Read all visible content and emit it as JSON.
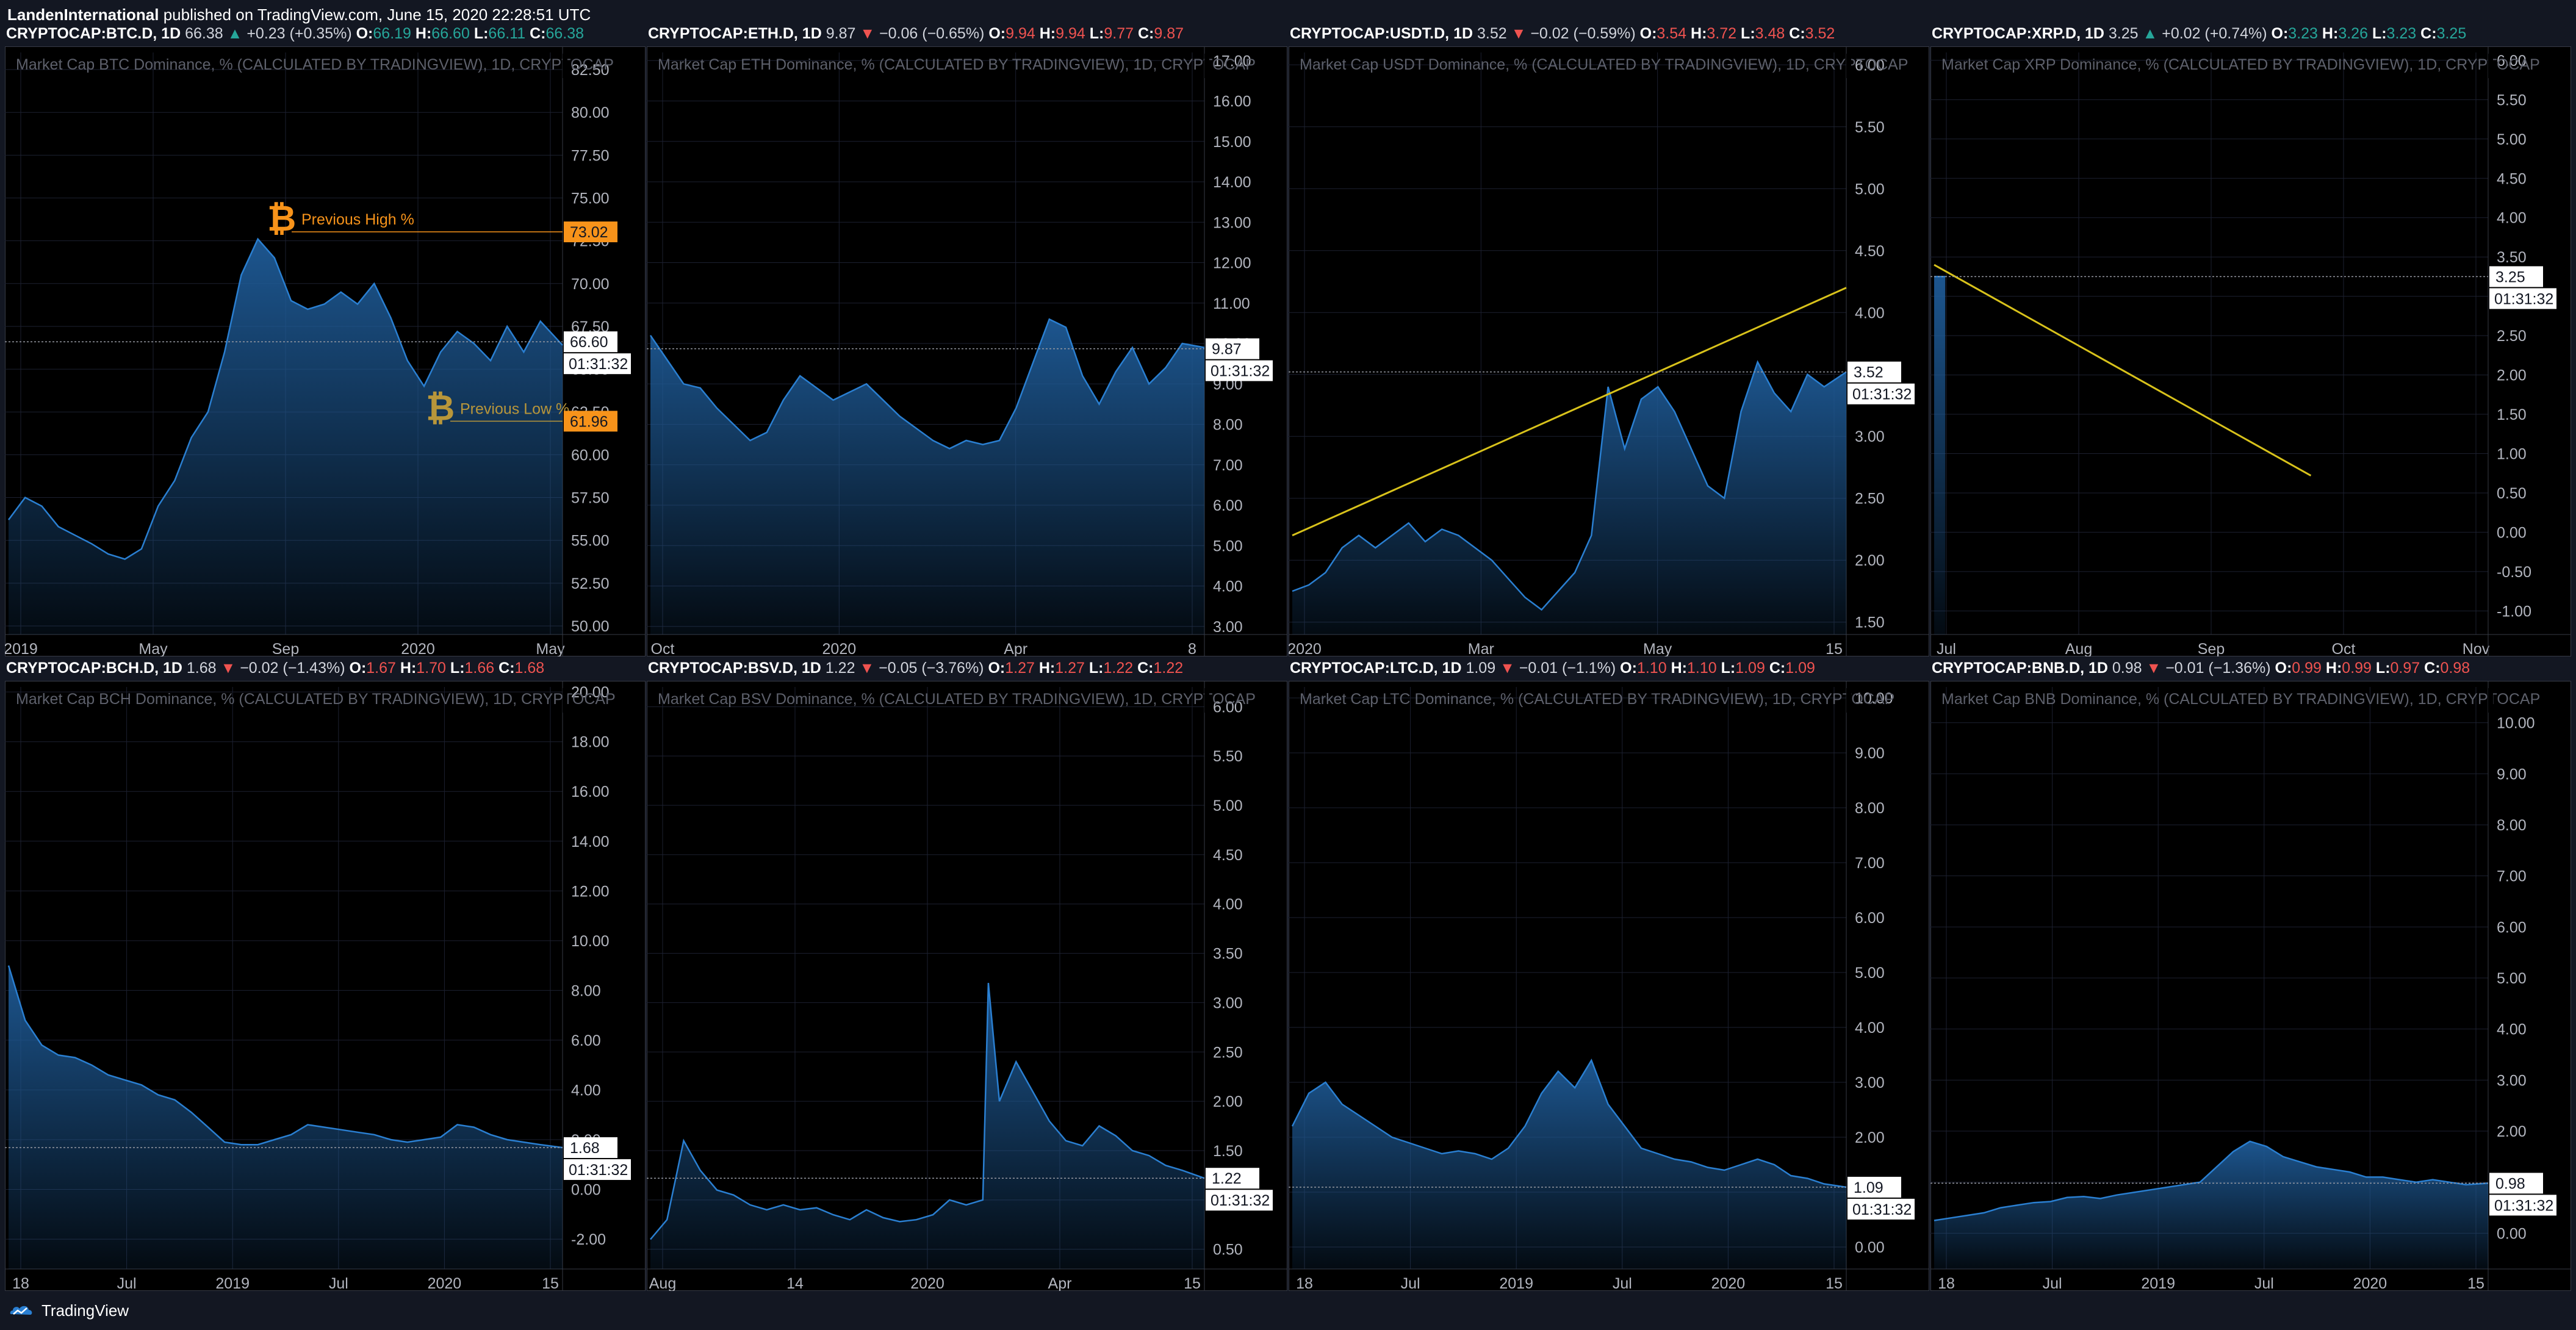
{
  "header": {
    "author": "LandenInternational",
    "published": "published on TradingView.com, June 15, 2020 22:28:51 UTC"
  },
  "footer": {
    "brand": "TradingView"
  },
  "colors": {
    "line": "#2a7fd1",
    "fill_top": "#1e5a96",
    "up": "#26a69a",
    "down": "#ef5350",
    "trend": "#d8c21b",
    "btc": "#f7931a"
  },
  "countdown": "01:31:32",
  "panels": [
    {
      "symbol": "CRYPTOCAP:BTC.D, 1D",
      "last": "66.38",
      "dir": "up",
      "change": "+0.23 (+0.35%)",
      "o": "66.19",
      "h": "66.60",
      "l": "66.11",
      "c": "66.38",
      "title": "Market Cap BTC Dominance, % (CALCULATED BY TRADINGVIEW), 1D, CRYPTOCAP",
      "price_label": "66.60"
    },
    {
      "symbol": "CRYPTOCAP:ETH.D, 1D",
      "last": "9.87",
      "dir": "down",
      "change": "−0.06 (−0.65%)",
      "o": "9.94",
      "h": "9.94",
      "l": "9.77",
      "c": "9.87",
      "title": "Market Cap ETH Dominance, % (CALCULATED BY TRADINGVIEW), 1D, CRYPTOCAP",
      "price_label": "9.87"
    },
    {
      "symbol": "CRYPTOCAP:USDT.D, 1D",
      "last": "3.52",
      "dir": "down",
      "change": "−0.02 (−0.59%)",
      "o": "3.54",
      "h": "3.72",
      "l": "3.48",
      "c": "3.52",
      "title": "Market Cap USDT Dominance, % (CALCULATED BY TRADINGVIEW), 1D, CRYPTOCAP",
      "price_label": "3.52"
    },
    {
      "symbol": "CRYPTOCAP:XRP.D, 1D",
      "last": "3.25",
      "dir": "up",
      "change": "+0.02 (+0.74%)",
      "o": "3.23",
      "h": "3.26",
      "l": "3.23",
      "c": "3.25",
      "title": "Market Cap XRP Dominance, % (CALCULATED BY TRADINGVIEW), 1D, CRYPTOCAP",
      "price_label": "3.25"
    },
    {
      "symbol": "CRYPTOCAP:BCH.D, 1D",
      "last": "1.68",
      "dir": "down",
      "change": "−0.02 (−1.43%)",
      "o": "1.67",
      "h": "1.70",
      "l": "1.66",
      "c": "1.68",
      "title": "Market Cap BCH Dominance, % (CALCULATED BY TRADINGVIEW), 1D, CRYPTOCAP",
      "price_label": "1.68"
    },
    {
      "symbol": "CRYPTOCAP:BSV.D, 1D",
      "last": "1.22",
      "dir": "down",
      "change": "−0.05 (−3.76%)",
      "o": "1.27",
      "h": "1.27",
      "l": "1.22",
      "c": "1.22",
      "title": "Market Cap BSV Dominance, % (CALCULATED BY TRADINGVIEW), 1D, CRYPTOCAP",
      "price_label": "1.22"
    },
    {
      "symbol": "CRYPTOCAP:LTC.D, 1D",
      "last": "1.09",
      "dir": "down",
      "change": "−0.01 (−1.1%)",
      "o": "1.10",
      "h": "1.10",
      "l": "1.09",
      "c": "1.09",
      "title": "Market Cap LTC Dominance, % (CALCULATED BY TRADINGVIEW), 1D, CRYPTOCAP",
      "price_label": "1.09"
    },
    {
      "symbol": "CRYPTOCAP:BNB.D, 1D",
      "last": "0.98",
      "dir": "down",
      "change": "−0.01 (−1.36%)",
      "o": "0.99",
      "h": "0.99",
      "l": "0.97",
      "c": "0.98",
      "title": "Market Cap BNB Dominance, % (CALCULATED BY TRADINGVIEW), 1D, CRYPTOCAP",
      "price_label": "0.98"
    }
  ],
  "chart_data": [
    {
      "type": "area",
      "title": "Market Cap BTC Dominance, % (CALCULATED BY TRADINGVIEW), 1D, CRYPTOCAP",
      "ylim": [
        49.5,
        83.5
      ],
      "yticks": [
        "82.50",
        "80.00",
        "77.50",
        "75.00",
        "72.50",
        "70.00",
        "67.50",
        "65.00",
        "62.50",
        "60.00",
        "57.50",
        "55.00",
        "52.50",
        "50.00"
      ],
      "xticks": [
        "2019",
        "May",
        "Sep",
        "2020",
        "May"
      ],
      "x": [
        0,
        0.03,
        0.06,
        0.09,
        0.12,
        0.15,
        0.18,
        0.21,
        0.24,
        0.27,
        0.3,
        0.33,
        0.36,
        0.39,
        0.42,
        0.45,
        0.48,
        0.51,
        0.54,
        0.57,
        0.6,
        0.63,
        0.66,
        0.69,
        0.72,
        0.75,
        0.78,
        0.81,
        0.84,
        0.87,
        0.9,
        0.93,
        0.96,
        1.0
      ],
      "y": [
        56.2,
        57.5,
        57.0,
        55.8,
        55.3,
        54.8,
        54.2,
        53.9,
        54.5,
        57.0,
        58.5,
        61.0,
        62.5,
        66.0,
        70.5,
        72.6,
        71.5,
        69.0,
        68.5,
        68.8,
        69.5,
        68.8,
        70.0,
        68.0,
        65.5,
        64.0,
        66.0,
        67.2,
        66.5,
        65.5,
        67.5,
        66.0,
        67.8,
        66.4
      ],
      "annotations": [
        {
          "text": "Previous High %",
          "value": "73.02"
        },
        {
          "text": "Previous Low %",
          "value": "61.96"
        }
      ]
    },
    {
      "type": "area",
      "title": "Market Cap ETH Dominance, % (CALCULATED BY TRADINGVIEW), 1D, CRYPTOCAP",
      "ylim": [
        2.8,
        17.2
      ],
      "yticks": [
        "17.00",
        "16.00",
        "15.00",
        "14.00",
        "13.00",
        "12.00",
        "11.00",
        "10.00",
        "9.00",
        "8.00",
        "7.00",
        "6.00",
        "5.00",
        "4.00",
        "3.00"
      ],
      "xticks": [
        "Oct",
        "2020",
        "Apr",
        "8"
      ],
      "x": [
        0,
        0.03,
        0.06,
        0.09,
        0.12,
        0.15,
        0.18,
        0.21,
        0.24,
        0.27,
        0.3,
        0.33,
        0.36,
        0.39,
        0.42,
        0.45,
        0.48,
        0.51,
        0.54,
        0.57,
        0.6,
        0.63,
        0.66,
        0.69,
        0.72,
        0.75,
        0.78,
        0.81,
        0.84,
        0.87,
        0.9,
        0.93,
        0.96,
        1.0
      ],
      "y": [
        10.2,
        9.6,
        9.0,
        8.9,
        8.4,
        8.0,
        7.6,
        7.8,
        8.6,
        9.2,
        8.9,
        8.6,
        8.8,
        9.0,
        8.6,
        8.2,
        7.9,
        7.6,
        7.4,
        7.6,
        7.5,
        7.6,
        8.4,
        9.5,
        10.6,
        10.4,
        9.2,
        8.5,
        9.3,
        9.9,
        9.0,
        9.4,
        10.0,
        9.9
      ]
    },
    {
      "type": "area",
      "title": "Market Cap USDT Dominance, % (CALCULATED BY TRADINGVIEW), 1D, CRYPTOCAP",
      "ylim": [
        1.4,
        6.1
      ],
      "yticks": [
        "6.00",
        "5.50",
        "5.00",
        "4.50",
        "4.00",
        "3.50",
        "3.00",
        "2.50",
        "2.00",
        "1.50"
      ],
      "xticks": [
        "2020",
        "Mar",
        "May",
        "15"
      ],
      "x": [
        0,
        0.03,
        0.06,
        0.09,
        0.12,
        0.15,
        0.18,
        0.21,
        0.24,
        0.27,
        0.3,
        0.33,
        0.36,
        0.39,
        0.42,
        0.45,
        0.48,
        0.51,
        0.54,
        0.57,
        0.6,
        0.63,
        0.66,
        0.69,
        0.72,
        0.75,
        0.78,
        0.81,
        0.84,
        0.87,
        0.9,
        0.93,
        0.96,
        1.0
      ],
      "y": [
        1.75,
        1.8,
        1.9,
        2.1,
        2.2,
        2.1,
        2.2,
        2.3,
        2.15,
        2.25,
        2.2,
        2.1,
        2.0,
        1.85,
        1.7,
        1.6,
        1.75,
        1.9,
        2.2,
        3.4,
        2.9,
        3.3,
        3.4,
        3.2,
        2.9,
        2.6,
        2.5,
        3.2,
        3.6,
        3.35,
        3.2,
        3.5,
        3.4,
        3.52
      ],
      "trendline": [
        2.2,
        4.2
      ]
    },
    {
      "type": "area",
      "title": "Market Cap XRP Dominance, % (CALCULATED BY TRADINGVIEW), 1D, CRYPTOCAP",
      "ylim": [
        -1.3,
        6.1
      ],
      "yticks": [
        "6.00",
        "5.50",
        "5.00",
        "4.50",
        "4.00",
        "3.50",
        "3.00",
        "2.50",
        "2.00",
        "1.50",
        "1.00",
        "0.50",
        "0.00",
        "-0.50",
        "-1.00"
      ],
      "xticks": [
        "Jul",
        "Aug",
        "Sep",
        "Oct",
        "Nov"
      ],
      "x": [
        0,
        0.02
      ],
      "y": [
        3.25,
        3.25
      ],
      "trendline": [
        3.4,
        0.72
      ]
    },
    {
      "type": "area",
      "title": "Market Cap BCH Dominance, % (CALCULATED BY TRADINGVIEW), 1D, CRYPTOCAP",
      "ylim": [
        -3.2,
        20.2
      ],
      "yticks": [
        "20.00",
        "18.00",
        "16.00",
        "14.00",
        "12.00",
        "10.00",
        "8.00",
        "6.00",
        "4.00",
        "2.00",
        "0.00",
        "-2.00"
      ],
      "xticks": [
        "18",
        "Jul",
        "2019",
        "Jul",
        "2020",
        "15"
      ],
      "x": [
        0,
        0.03,
        0.06,
        0.09,
        0.12,
        0.15,
        0.18,
        0.21,
        0.24,
        0.27,
        0.3,
        0.33,
        0.36,
        0.39,
        0.42,
        0.45,
        0.48,
        0.51,
        0.54,
        0.57,
        0.6,
        0.63,
        0.66,
        0.69,
        0.72,
        0.75,
        0.78,
        0.81,
        0.84,
        0.87,
        0.9,
        0.93,
        0.96,
        1.0
      ],
      "y": [
        9.0,
        6.8,
        5.8,
        5.4,
        5.3,
        5.0,
        4.6,
        4.4,
        4.2,
        3.8,
        3.6,
        3.1,
        2.5,
        1.9,
        1.8,
        1.8,
        2.0,
        2.2,
        2.6,
        2.5,
        2.4,
        2.3,
        2.2,
        2.0,
        1.9,
        2.0,
        2.1,
        2.6,
        2.5,
        2.2,
        2.0,
        1.9,
        1.8,
        1.68
      ]
    },
    {
      "type": "area",
      "title": "Market Cap BSV Dominance, % (CALCULATED BY TRADINGVIEW), 1D, CRYPTOCAP",
      "ylim": [
        0.3,
        6.2
      ],
      "yticks": [
        "6.00",
        "5.50",
        "5.00",
        "4.50",
        "4.00",
        "3.50",
        "3.00",
        "2.50",
        "2.00",
        "1.50",
        "1.00",
        "0.50"
      ],
      "xticks": [
        "Aug",
        "14",
        "2020",
        "Apr",
        "15"
      ],
      "x": [
        0,
        0.03,
        0.06,
        0.09,
        0.12,
        0.15,
        0.18,
        0.21,
        0.24,
        0.27,
        0.3,
        0.33,
        0.36,
        0.39,
        0.42,
        0.45,
        0.48,
        0.51,
        0.54,
        0.57,
        0.6,
        0.61,
        0.63,
        0.66,
        0.69,
        0.72,
        0.75,
        0.78,
        0.81,
        0.84,
        0.87,
        0.9,
        0.93,
        0.96,
        1.0
      ],
      "y": [
        0.6,
        0.8,
        1.6,
        1.3,
        1.1,
        1.05,
        0.95,
        0.9,
        0.95,
        0.9,
        0.92,
        0.85,
        0.8,
        0.9,
        0.82,
        0.78,
        0.8,
        0.85,
        1.0,
        0.95,
        1.0,
        3.2,
        2.0,
        2.4,
        2.1,
        1.8,
        1.6,
        1.55,
        1.75,
        1.65,
        1.5,
        1.45,
        1.35,
        1.3,
        1.22
      ]
    },
    {
      "type": "area",
      "title": "Market Cap LTC Dominance, % (CALCULATED BY TRADINGVIEW), 1D, CRYPTOCAP",
      "ylim": [
        -0.4,
        10.2
      ],
      "yticks": [
        "10.00",
        "9.00",
        "8.00",
        "7.00",
        "6.00",
        "5.00",
        "4.00",
        "3.00",
        "2.00",
        "1.00",
        "0.00"
      ],
      "xticks": [
        "18",
        "Jul",
        "2019",
        "Jul",
        "2020",
        "15"
      ],
      "x": [
        0,
        0.03,
        0.06,
        0.09,
        0.12,
        0.15,
        0.18,
        0.21,
        0.24,
        0.27,
        0.3,
        0.33,
        0.36,
        0.39,
        0.42,
        0.45,
        0.48,
        0.51,
        0.54,
        0.57,
        0.6,
        0.63,
        0.66,
        0.69,
        0.72,
        0.75,
        0.78,
        0.81,
        0.84,
        0.87,
        0.9,
        0.93,
        0.96,
        1.0
      ],
      "y": [
        2.2,
        2.8,
        3.0,
        2.6,
        2.4,
        2.2,
        2.0,
        1.9,
        1.8,
        1.7,
        1.75,
        1.7,
        1.6,
        1.8,
        2.2,
        2.8,
        3.2,
        2.9,
        3.4,
        2.6,
        2.2,
        1.8,
        1.7,
        1.6,
        1.55,
        1.45,
        1.4,
        1.5,
        1.6,
        1.5,
        1.3,
        1.25,
        1.15,
        1.09
      ]
    },
    {
      "type": "area",
      "title": "Market Cap BNB Dominance, % (CALCULATED BY TRADINGVIEW), 1D, CRYPTOCAP",
      "ylim": [
        -0.7,
        10.7
      ],
      "yticks": [
        "10.00",
        "9.00",
        "8.00",
        "7.00",
        "6.00",
        "5.00",
        "4.00",
        "3.00",
        "2.00",
        "1.00",
        "0.00"
      ],
      "xticks": [
        "18",
        "Jul",
        "2019",
        "Jul",
        "2020",
        "15"
      ],
      "x": [
        0,
        0.03,
        0.06,
        0.09,
        0.12,
        0.15,
        0.18,
        0.21,
        0.24,
        0.27,
        0.3,
        0.33,
        0.36,
        0.39,
        0.42,
        0.45,
        0.48,
        0.51,
        0.54,
        0.57,
        0.6,
        0.63,
        0.66,
        0.69,
        0.72,
        0.75,
        0.78,
        0.81,
        0.84,
        0.87,
        0.9,
        0.93,
        0.96,
        1.0
      ],
      "y": [
        0.25,
        0.3,
        0.35,
        0.4,
        0.5,
        0.55,
        0.6,
        0.62,
        0.7,
        0.72,
        0.68,
        0.75,
        0.8,
        0.85,
        0.9,
        0.95,
        1.0,
        1.3,
        1.6,
        1.8,
        1.7,
        1.5,
        1.4,
        1.3,
        1.25,
        1.2,
        1.1,
        1.1,
        1.05,
        1.0,
        1.05,
        1.0,
        0.95,
        0.98
      ]
    }
  ]
}
